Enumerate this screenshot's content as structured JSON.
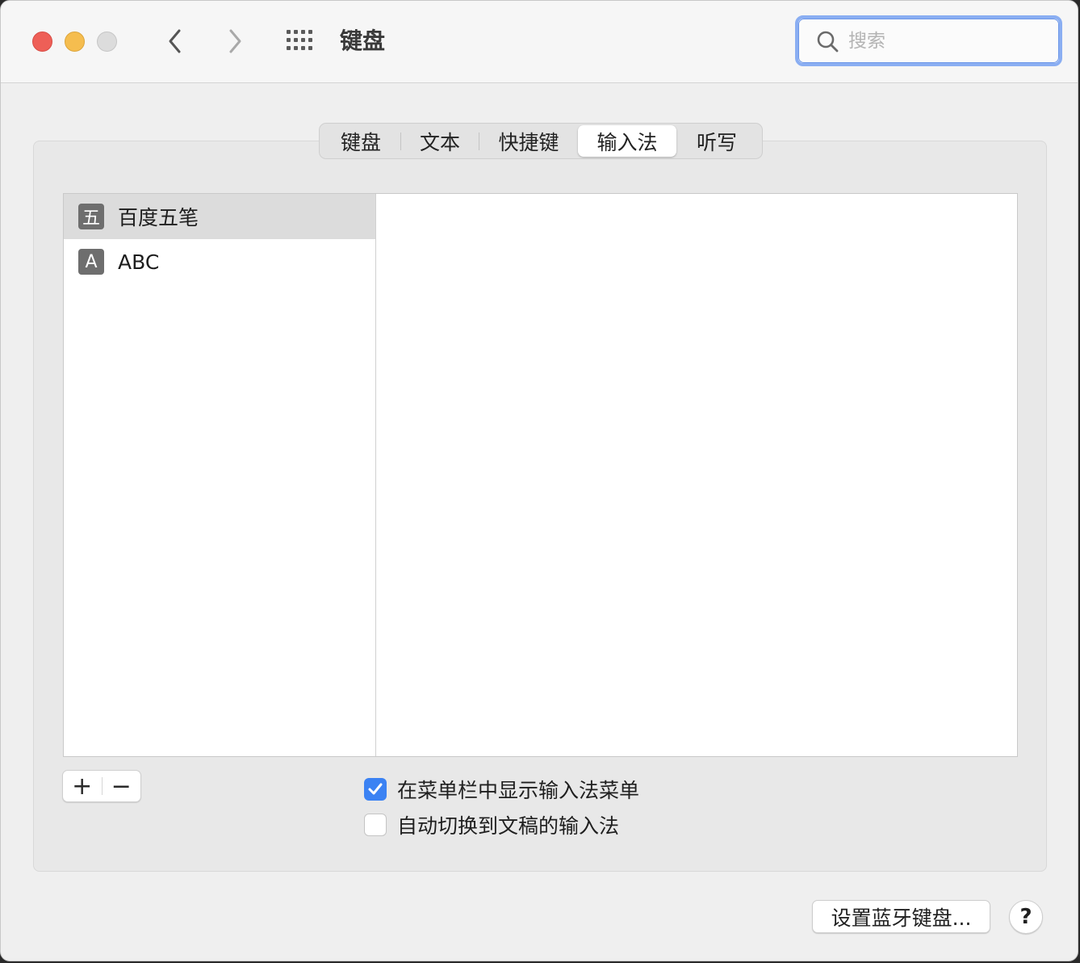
{
  "window": {
    "title": "键盘"
  },
  "search": {
    "placeholder": "搜索",
    "value": ""
  },
  "tabs": [
    {
      "label": "键盘",
      "active": false
    },
    {
      "label": "文本",
      "active": false
    },
    {
      "label": "快捷键",
      "active": false
    },
    {
      "label": "输入法",
      "active": true
    },
    {
      "label": "听写",
      "active": false
    }
  ],
  "input_sources": [
    {
      "icon_char": "五",
      "label": "百度五笔",
      "selected": true
    },
    {
      "icon_char": "A",
      "label": "ABC",
      "selected": false
    }
  ],
  "list_controls": {
    "add_label": "+",
    "remove_label": "−"
  },
  "options": [
    {
      "label": "在菜单栏中显示输入法菜单",
      "checked": true
    },
    {
      "label": "自动切换到文稿的输入法",
      "checked": false
    }
  ],
  "footer": {
    "bluetooth_button_label": "设置蓝牙键盘...",
    "help_button_label": "?"
  },
  "colors": {
    "accent": "#3b82f3",
    "close": "#ee5f57",
    "minimize": "#f5bd4f",
    "zoom_inactive": "#dcdcdc",
    "search_focus": "#8aaef2"
  },
  "icons": {
    "back": "chevron-left-icon",
    "forward": "chevron-right-icon",
    "grid": "show-all-grid-icon",
    "search": "magnifying-glass-icon",
    "check": "checkmark-icon"
  }
}
